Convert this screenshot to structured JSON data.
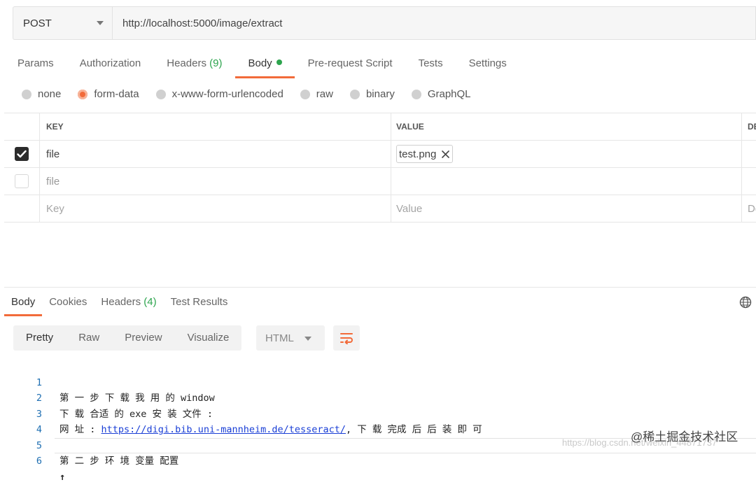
{
  "request": {
    "method": "POST",
    "url": "http://localhost:5000/image/extract"
  },
  "request_tabs": [
    {
      "label": "Params",
      "count": ""
    },
    {
      "label": "Authorization",
      "count": ""
    },
    {
      "label": "Headers",
      "count": "(9)"
    },
    {
      "label": "Body",
      "count": ""
    },
    {
      "label": "Pre-request Script",
      "count": ""
    },
    {
      "label": "Tests",
      "count": ""
    },
    {
      "label": "Settings",
      "count": ""
    }
  ],
  "body_types": [
    "none",
    "form-data",
    "x-www-form-urlencoded",
    "raw",
    "binary",
    "GraphQL"
  ],
  "form_table": {
    "headers": {
      "key": "KEY",
      "value": "VALUE",
      "description": "DESC"
    },
    "rows": [
      {
        "key": "file",
        "value_file": "test.png",
        "checked": true
      },
      {
        "key": "file",
        "value_file": "",
        "checked": false
      }
    ],
    "placeholders": {
      "key": "Key",
      "value": "Value",
      "description": "Des"
    }
  },
  "response_tabs": [
    {
      "label": "Body",
      "count": ""
    },
    {
      "label": "Cookies",
      "count": ""
    },
    {
      "label": "Headers",
      "count": "(4)"
    },
    {
      "label": "Test Results",
      "count": ""
    }
  ],
  "view_modes": [
    "Pretty",
    "Raw",
    "Preview",
    "Visualize"
  ],
  "language": "HTML",
  "code_lines": [
    {
      "num": "1",
      "text": "第 一 步 下 载 我 用 的 window"
    },
    {
      "num": "2",
      "text": "下 载 合适 的 exe 安 装 文件 :"
    },
    {
      "num": "3",
      "prefix": "网 址 : ",
      "link": "https://digi.bib.uni-mannheim.de/tesseract/",
      "suffix": ", 下 载 完成 后 后 装 即 可"
    },
    {
      "num": "4",
      "text": ""
    },
    {
      "num": "5",
      "text": "第 二 步 环 境 变量 配置"
    },
    {
      "num": "6",
      "text": "↑"
    }
  ],
  "watermark": "@稀土掘金技术社区",
  "watermark_faint": "https://blog.csdn.net/weixin_44871737",
  "colors": {
    "accent": "#f26b3a",
    "success": "#2da44e",
    "link": "#1a3fd6"
  }
}
